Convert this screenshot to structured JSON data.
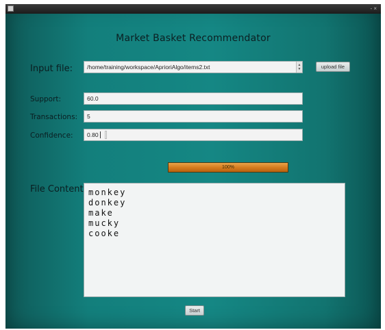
{
  "window": {
    "controls": "- ×"
  },
  "title": "Market Basket Recommendator",
  "input_file": {
    "label": "Input file:",
    "value": "/home/training/workspace/AprioriAlgo/items2.txt",
    "upload_label": "upload file"
  },
  "support": {
    "label": "Support:",
    "value": "60.0"
  },
  "transactions": {
    "label": "Transactions:",
    "value": "5"
  },
  "confidence": {
    "label": "Confidence:",
    "value": "0.80"
  },
  "progress": {
    "value": 1.0,
    "text": "100%"
  },
  "file_content": {
    "label": "File Content:",
    "lines": [
      "monkey",
      "donkey",
      "make",
      "mucky",
      "cooke"
    ]
  },
  "start_label": "Start",
  "colors": {
    "background": "#158784",
    "progress_fill": "#d67d1f"
  }
}
